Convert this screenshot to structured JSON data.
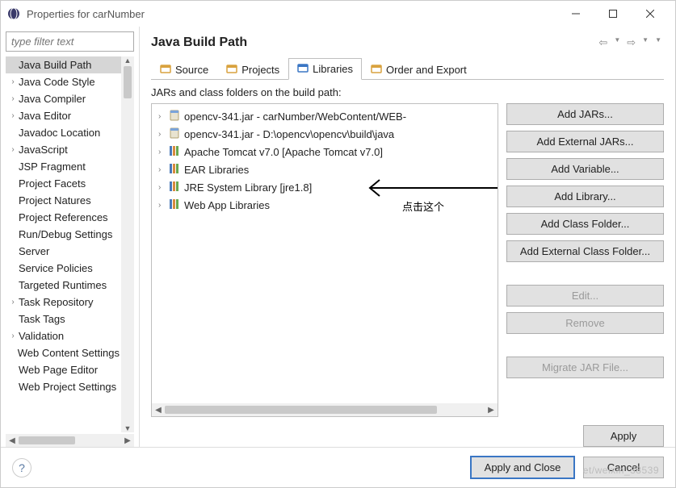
{
  "window": {
    "title": "Properties for carNumber"
  },
  "filter": {
    "placeholder": "type filter text"
  },
  "sidebar": {
    "items": [
      {
        "label": "Java Build Path",
        "expandable": false,
        "selected": true
      },
      {
        "label": "Java Code Style",
        "expandable": true
      },
      {
        "label": "Java Compiler",
        "expandable": true
      },
      {
        "label": "Java Editor",
        "expandable": true
      },
      {
        "label": "Javadoc Location",
        "expandable": false
      },
      {
        "label": "JavaScript",
        "expandable": true
      },
      {
        "label": "JSP Fragment",
        "expandable": false
      },
      {
        "label": "Project Facets",
        "expandable": false
      },
      {
        "label": "Project Natures",
        "expandable": false
      },
      {
        "label": "Project References",
        "expandable": false
      },
      {
        "label": "Run/Debug Settings",
        "expandable": false
      },
      {
        "label": "Server",
        "expandable": false
      },
      {
        "label": "Service Policies",
        "expandable": false
      },
      {
        "label": "Targeted Runtimes",
        "expandable": false
      },
      {
        "label": "Task Repository",
        "expandable": true
      },
      {
        "label": "Task Tags",
        "expandable": false
      },
      {
        "label": "Validation",
        "expandable": true
      },
      {
        "label": "Web Content Settings",
        "expandable": false
      },
      {
        "label": "Web Page Editor",
        "expandable": false
      },
      {
        "label": "Web Project Settings",
        "expandable": false
      }
    ]
  },
  "page": {
    "title": "Java Build Path"
  },
  "tabs": {
    "items": [
      {
        "label": "Source"
      },
      {
        "label": "Projects"
      },
      {
        "label": "Libraries",
        "active": true
      },
      {
        "label": "Order and Export"
      }
    ]
  },
  "list": {
    "heading": "JARs and class folders on the build path:",
    "items": [
      {
        "icon": "jar",
        "label": "opencv-341.jar - carNumber/WebContent/WEB-"
      },
      {
        "icon": "jar",
        "label": "opencv-341.jar - D:\\opencv\\opencv\\build\\java"
      },
      {
        "icon": "lib",
        "label": "Apache Tomcat v7.0 [Apache Tomcat v7.0]"
      },
      {
        "icon": "lib",
        "label": "EAR Libraries"
      },
      {
        "icon": "lib",
        "label": "JRE System Library [jre1.8]"
      },
      {
        "icon": "lib",
        "label": "Web App Libraries"
      }
    ]
  },
  "annotation": {
    "text": "点击这个"
  },
  "buttons": {
    "add_jars": "Add JARs...",
    "add_external_jars": "Add External JARs...",
    "add_variable": "Add Variable...",
    "add_library": "Add Library...",
    "add_class_folder": "Add Class Folder...",
    "add_external_class_folder": "Add External Class Folder...",
    "edit": "Edit...",
    "remove": "Remove",
    "migrate": "Migrate JAR File...",
    "apply": "Apply",
    "apply_close": "Apply and Close",
    "cancel": "Cancel"
  }
}
